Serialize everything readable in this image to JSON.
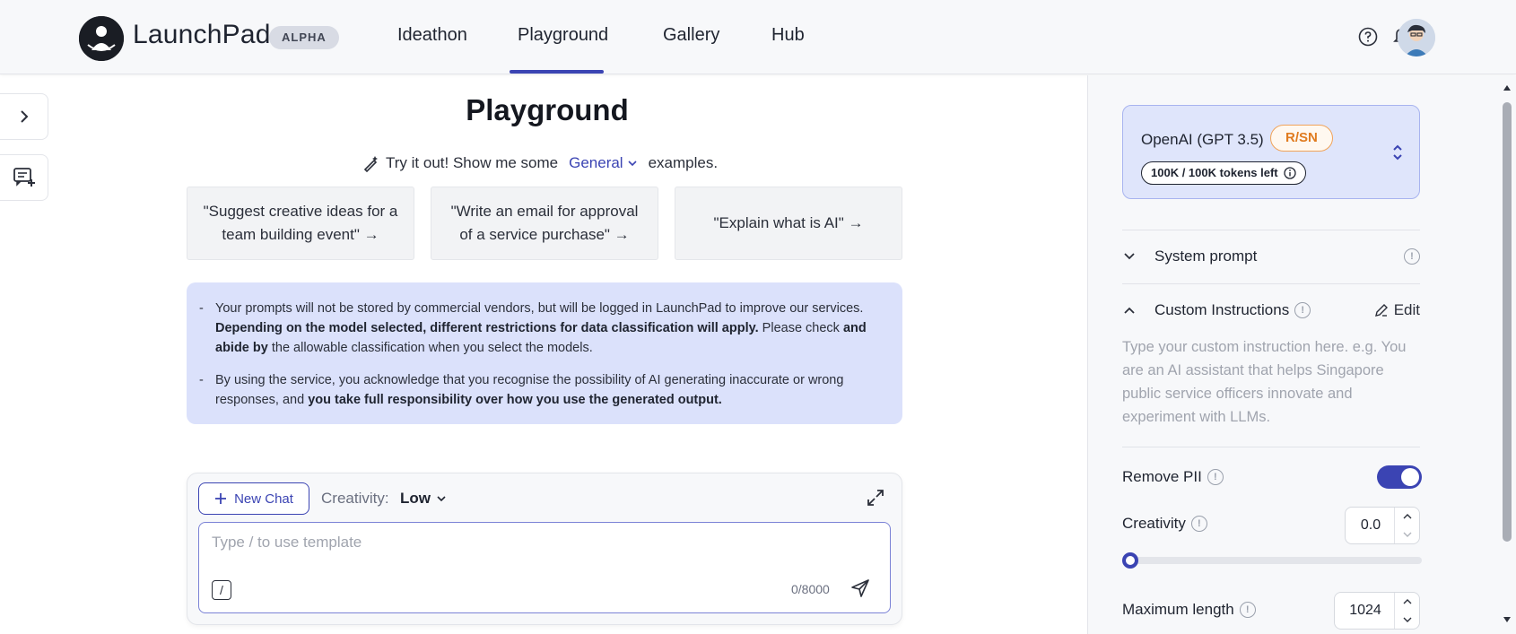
{
  "header": {
    "brand": "LaunchPad",
    "badge": "ALPHA",
    "nav": [
      "Ideathon",
      "Playground",
      "Gallery",
      "Hub"
    ],
    "active_nav": "Playground",
    "icons": [
      "help-circle-icon",
      "bell-icon",
      "user-avatar"
    ]
  },
  "main": {
    "title": "Playground",
    "try_prefix": "Try it out! Show me some",
    "category": "General",
    "try_suffix": "examples.",
    "examples": [
      "\"Suggest creative ideas for a team building event\" →",
      "\"Write an email for approval of a service purchase\" →",
      "\"Explain what is AI\" →"
    ],
    "notice": {
      "p1_a": "Your prompts will not be stored by commercial vendors, but will be logged in LaunchPad to improve our services.",
      "p1_b": "Depending on the model selected, different restrictions for data classification will apply.",
      "p1_c": "Please check",
      "p1_d": "and abide by",
      "p1_e": "the allowable classification when you select the models.",
      "p2_a": "By using the service, you acknowledge that you recognise the possibility of AI generating inaccurate or wrong responses, and",
      "p2_b": "you take full responsibility over how you use the generated output."
    }
  },
  "chat": {
    "new_chat": "New Chat",
    "creativity_label": "Creativity:",
    "creativity_value": "Low",
    "placeholder": "Type / to use template",
    "slash": "/",
    "counter": "0/8000"
  },
  "panel": {
    "model": "OpenAI (GPT 3.5)",
    "classification": "R/SN",
    "tokens": "100K / 100K tokens left",
    "system_prompt": "System prompt",
    "custom_instructions": "Custom Instructions",
    "edit": "Edit",
    "custom_placeholder": "Type your custom instruction here. e.g. You are an AI assistant that helps Singapore public service officers innovate and experiment with LLMs.",
    "remove_pii": "Remove PII",
    "remove_pii_on": true,
    "creativity": "Creativity",
    "creativity_value": "0.0",
    "creativity_level": 0,
    "max_length": "Maximum length",
    "max_length_value": "1024"
  },
  "colors": {
    "accent": "#3b44b3",
    "notice_bg": "#dbe1fb",
    "classification": "#e07b1f"
  }
}
